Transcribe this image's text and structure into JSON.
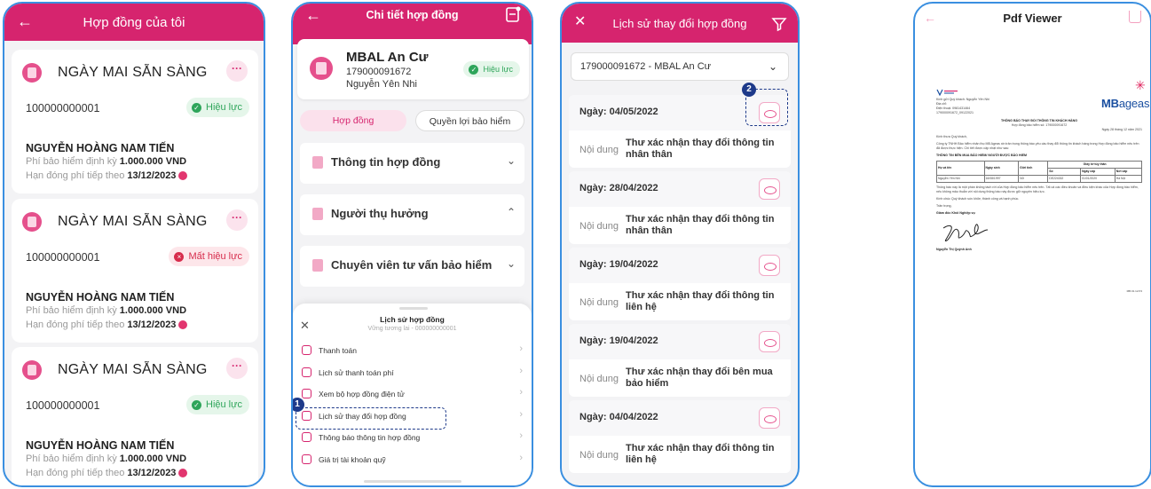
{
  "screen1": {
    "title": "Hợp đồng của tôi",
    "cards": [
      {
        "title": "NGÀY MAI SẴN SÀNG",
        "number": "100000000001",
        "status": "Hiệu lực",
        "status_type": "ok",
        "name": "NGUYỄN HOÀNG NAM TIẾN",
        "fee_label": "Phí bảo hiểm định kỳ",
        "fee_value": "1.000.000 VND",
        "due_label": "Hạn đóng phí tiếp theo",
        "due_value": "13/12/2023"
      },
      {
        "title": "NGÀY MAI SẴN SÀNG",
        "number": "100000000001",
        "status": "Mất hiệu lực",
        "status_type": "bad",
        "name": "NGUYỄN HOÀNG NAM TIẾN",
        "fee_label": "Phí bảo hiểm định kỳ",
        "fee_value": "1.000.000 VND",
        "due_label": "Hạn đóng phí tiếp theo",
        "due_value": "13/12/2023"
      },
      {
        "title": "NGÀY MAI SẴN SÀNG",
        "number": "100000000001",
        "status": "Hiệu lực",
        "status_type": "ok",
        "name": "NGUYỄN HOÀNG NAM TIẾN",
        "fee_label": "Phí bảo hiểm định kỳ",
        "fee_value": "1.000.000 VND",
        "due_label": "Hạn đóng phí tiếp theo",
        "due_value": "13/12/2023"
      }
    ]
  },
  "screen2": {
    "title": "Chi tiết hợp đồng",
    "product": "MBAL An Cư",
    "contract_id": "179000091672",
    "insured": "Nguyễn Yên Nhi",
    "status": "Hiệu lực",
    "tabs": [
      "Hợp đồng",
      "Quyền lợi bảo hiểm"
    ],
    "sections": [
      {
        "label": "Thông tin hợp đồng",
        "chevron": "⌄"
      },
      {
        "label": "Người thụ hưởng",
        "chevron": "⌃"
      },
      {
        "label": "Chuyên viên tư vấn bảo hiểm",
        "chevron": "⌄"
      }
    ],
    "sheet": {
      "title": "Lịch sử hợp đồng",
      "subtitle": "Vững tương lai - 000000000001",
      "items": [
        "Thanh toán",
        "Lịch sử thanh toán phí",
        "Xem bộ hợp đồng điện tử",
        "Lịch sử thay đổi hợp đồng",
        "Thông báo thông tin hợp đồng",
        "Giá trị tài khoản quỹ"
      ]
    },
    "step": "1"
  },
  "screen3": {
    "title": "Lịch sử thay đổi hợp đồng",
    "selected_contract": "179000091672 - MBAL An Cư",
    "content_label": "Nội dung",
    "entries": [
      {
        "date": "Ngày: 04/05/2022",
        "content": "Thư xác nhận thay đổi thông tin nhân thân"
      },
      {
        "date": "Ngày: 28/04/2022",
        "content": "Thư xác nhận thay đổi thông tin nhân thân"
      },
      {
        "date": "Ngày: 19/04/2022",
        "content": "Thư xác nhận thay đổi thông tin liên hệ"
      },
      {
        "date": "Ngày: 19/04/2022",
        "content": "Thư xác nhận thay đổi bên mua bảo hiểm"
      },
      {
        "date": "Ngày: 04/04/2022",
        "content": "Thư xác nhận thay đổi thông tin liên hệ"
      }
    ],
    "step": "2"
  },
  "screen4": {
    "title": "Pdf Viewer",
    "doc": {
      "logo": "MB",
      "logo_suffix": "ageas",
      "greeting": "Kính gửi Quý khách: Nguyễn Yên Nhi",
      "address": "Địa chỉ:",
      "phone": "Điện thoại: 0981431464",
      "ref": "179000091672_09122021",
      "heading": "THÔNG BÁO THAY ĐỔI THÔNG TIN KHÁCH HÀNG",
      "subheading": "Hợp đồng bảo hiểm số: 179000091672",
      "date": "Ngày 28 tháng 12 năm 2021",
      "salutation": "Kính thưa Quý khách,",
      "body1": "Công ty TNHH Bảo hiểm nhân thọ MB Ageas xin trân trọng thông báo yêu cầu thay đổi thông tin khách hàng trong Hợp đồng bảo hiểm nêu trên đã được thực hiện. Chi tiết được cập nhật như sau:",
      "table_title": "THÔNG TIN BÊN MUA BẢO HIỂM/ NGƯỜI ĐƯỢC BẢO HIỂM",
      "table_head": [
        "Họ và tên",
        "Ngày sinh",
        "Giới tính",
        "Số",
        "Ngày cấp",
        "Nơi cấp"
      ],
      "table_group": "Giấy tờ tùy thân",
      "table_row": [
        "Nguyễn Yên Nhi",
        "16/08/1997",
        "Nữ",
        "DE224332",
        "01/01/2020",
        "Hà Nội"
      ],
      "body2": "Thông báo này là một phần không tách rời của Hợp đồng bảo hiểm nêu trên. Tất cả các điều khoản và điều kiện khác của Hợp đồng bảo hiểm, nếu không mâu thuẫn với nội dung thông báo này được giữ nguyên hiệu lực.",
      "closing": "Kính chúc Quý khách sức khỏe, thành công và hạnh phúc.",
      "regards": "Trân trọng,",
      "signer_title": "Giám đốc Khối Nghiệp vụ",
      "signer_name": "Nguyễn Thị Quỳnh Anh",
      "footer_code": "MB.01.12.P4"
    }
  },
  "colors": {
    "brand": "#d6246e",
    "success": "#2ea55a",
    "danger": "#d72c4c",
    "step": "#1e3a8a"
  }
}
